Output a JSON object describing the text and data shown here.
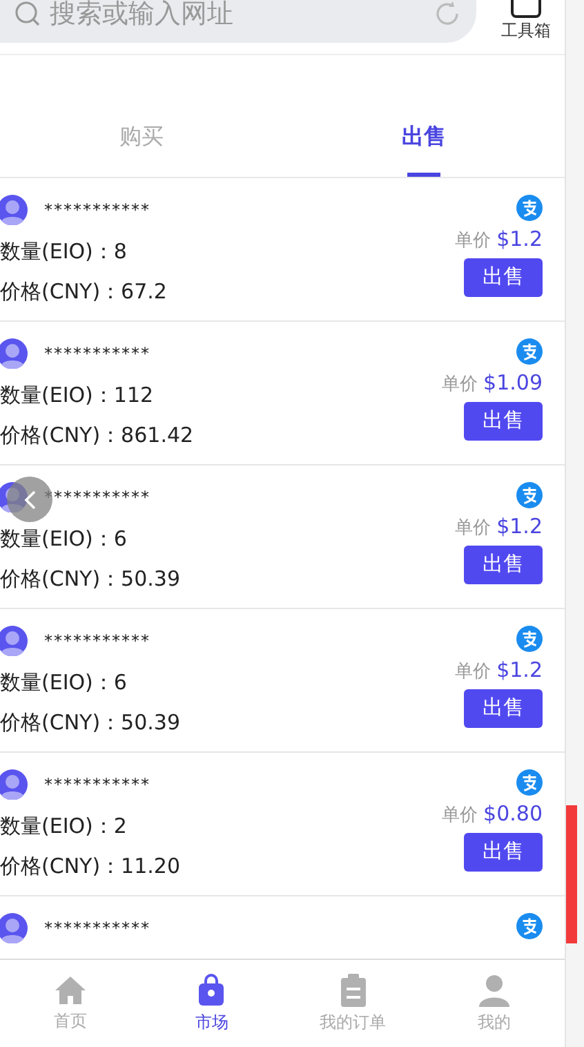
{
  "search": {
    "placeholder": "搜索或输入网址"
  },
  "toolbox": {
    "label": "工具箱"
  },
  "tabs": [
    {
      "label": "购买",
      "selected": false
    },
    {
      "label": "出售",
      "selected": true
    }
  ],
  "orders": [
    {
      "user": "***********",
      "quantity_label": "数量(EIO)：",
      "quantity": "8",
      "price_label": "价格(CNY)：",
      "price": "67.2",
      "unit_label": "单价",
      "unit_price": "$1.2",
      "action": "出售"
    },
    {
      "user": "***********",
      "quantity_label": "数量(EIO)：",
      "quantity": "112",
      "price_label": "价格(CNY)：",
      "price": "861.42",
      "unit_label": "单价",
      "unit_price": "$1.09",
      "action": "出售"
    },
    {
      "user": "***********",
      "quantity_label": "数量(EIO)：",
      "quantity": "6",
      "price_label": "价格(CNY)：",
      "price": "50.39",
      "unit_label": "单价",
      "unit_price": "$1.2",
      "action": "出售"
    },
    {
      "user": "***********",
      "quantity_label": "数量(EIO)：",
      "quantity": "6",
      "price_label": "价格(CNY)：",
      "price": "50.39",
      "unit_label": "单价",
      "unit_price": "$1.2",
      "action": "出售"
    },
    {
      "user": "***********",
      "quantity_label": "数量(EIO)：",
      "quantity": "2",
      "price_label": "价格(CNY)：",
      "price": "11.20",
      "unit_label": "单价",
      "unit_price": "$0.80",
      "action": "出售"
    },
    {
      "user": "***********"
    }
  ],
  "bottom_nav": [
    {
      "label": "首页",
      "kind": "home",
      "selected": false
    },
    {
      "label": "市场",
      "kind": "market",
      "selected": true
    },
    {
      "label": "我的订单",
      "kind": "orders",
      "selected": false
    },
    {
      "label": "我的",
      "kind": "profile",
      "selected": false
    }
  ]
}
